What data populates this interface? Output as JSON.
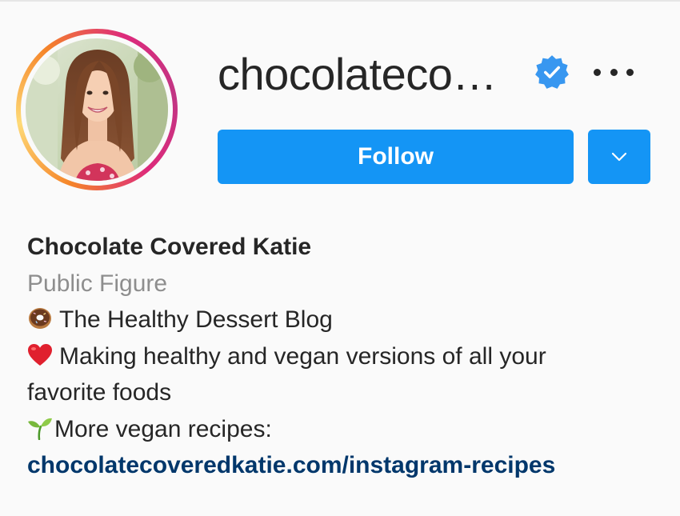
{
  "profile": {
    "username": "chocolateco…",
    "verified_icon": "verified-badge-icon",
    "more_icon": "more-options-icon",
    "avatar_icon": "profile-photo"
  },
  "actions": {
    "follow_label": "Follow",
    "dropdown_icon": "chevron-down-icon",
    "accent_color": "#1495f5"
  },
  "bio": {
    "full_name": "Chocolate Covered Katie",
    "category": "Public Figure",
    "line1_icon": "donut-emoji",
    "line1_text": "The Healthy Dessert Blog",
    "line2_icon": "heart-emoji",
    "line2_text_a": "Making healthy and vegan versions of all your",
    "line2_text_b": "favorite foods",
    "line3_icon": "seedling-emoji",
    "line3_text": "More vegan recipes:",
    "link": "chocolatecoveredkatie.com/instagram-recipes",
    "link_color": "#00376b"
  }
}
